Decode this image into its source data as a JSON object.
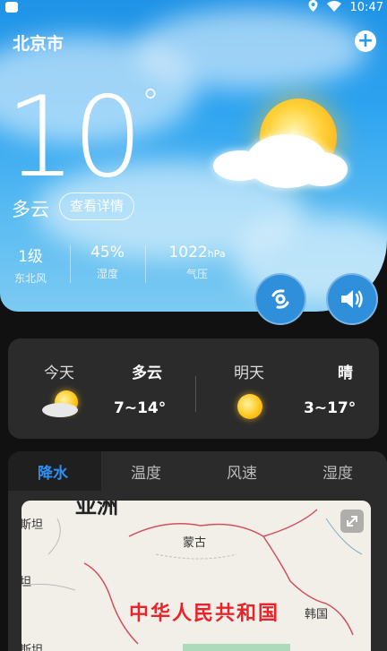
{
  "status_bar": {
    "time": "10:47"
  },
  "header": {
    "city": "北京市",
    "add_icon": "plus-circle-icon"
  },
  "current": {
    "temperature": "10",
    "degree_symbol": "°",
    "condition": "多云",
    "detail_button": "查看详情",
    "stats": [
      {
        "value": "1级",
        "unit": "",
        "label": "东北风"
      },
      {
        "value": "45%",
        "unit": "",
        "label": "湿度"
      },
      {
        "value": "1022",
        "unit": "hPa",
        "label": "气压"
      }
    ]
  },
  "actions": {
    "typhoon_icon": "typhoon-icon",
    "voice_icon": "speaker-icon"
  },
  "forecast": {
    "today": {
      "label": "今天",
      "condition": "多云",
      "range": "7~14°",
      "icon": "partly-cloudy-icon"
    },
    "tomorrow": {
      "label": "明天",
      "condition": "晴",
      "range": "3~17°",
      "icon": "sun-icon"
    }
  },
  "tabs": [
    "降水",
    "温度",
    "风速",
    "湿度"
  ],
  "map": {
    "labels": {
      "asia": "亚洲",
      "kaz": "斯坦",
      "mongolia": "蒙古",
      "china": "中华人民共和国",
      "korea": "韩国",
      "west1": "坦",
      "west2": "斯坦"
    }
  },
  "colors": {
    "accent": "#2f8ff0",
    "sky": "#2ea4f0",
    "china_label": "#e8232a"
  }
}
